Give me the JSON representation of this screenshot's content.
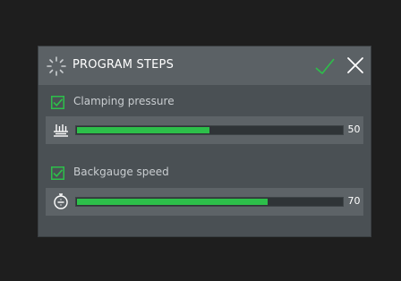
{
  "dialog": {
    "title": "PROGRAM STEPS",
    "header_icon": "adjust-steps-icon",
    "confirm_icon": "checkmark-icon",
    "close_icon": "close-icon"
  },
  "parameters": [
    {
      "label": "Clamping pressure",
      "checked": true,
      "icon": "clamping-pressure-icon",
      "value": "50",
      "level_percent": 50
    },
    {
      "label": "Backgauge speed",
      "checked": true,
      "icon": "stopwatch-icon",
      "value": "70",
      "level_percent": 72
    }
  ],
  "colors": {
    "accent": "#2dbf4a",
    "panel": "#4a5054",
    "header": "#5b6165",
    "track": "#2f3437",
    "background": "#1e1e1e"
  }
}
